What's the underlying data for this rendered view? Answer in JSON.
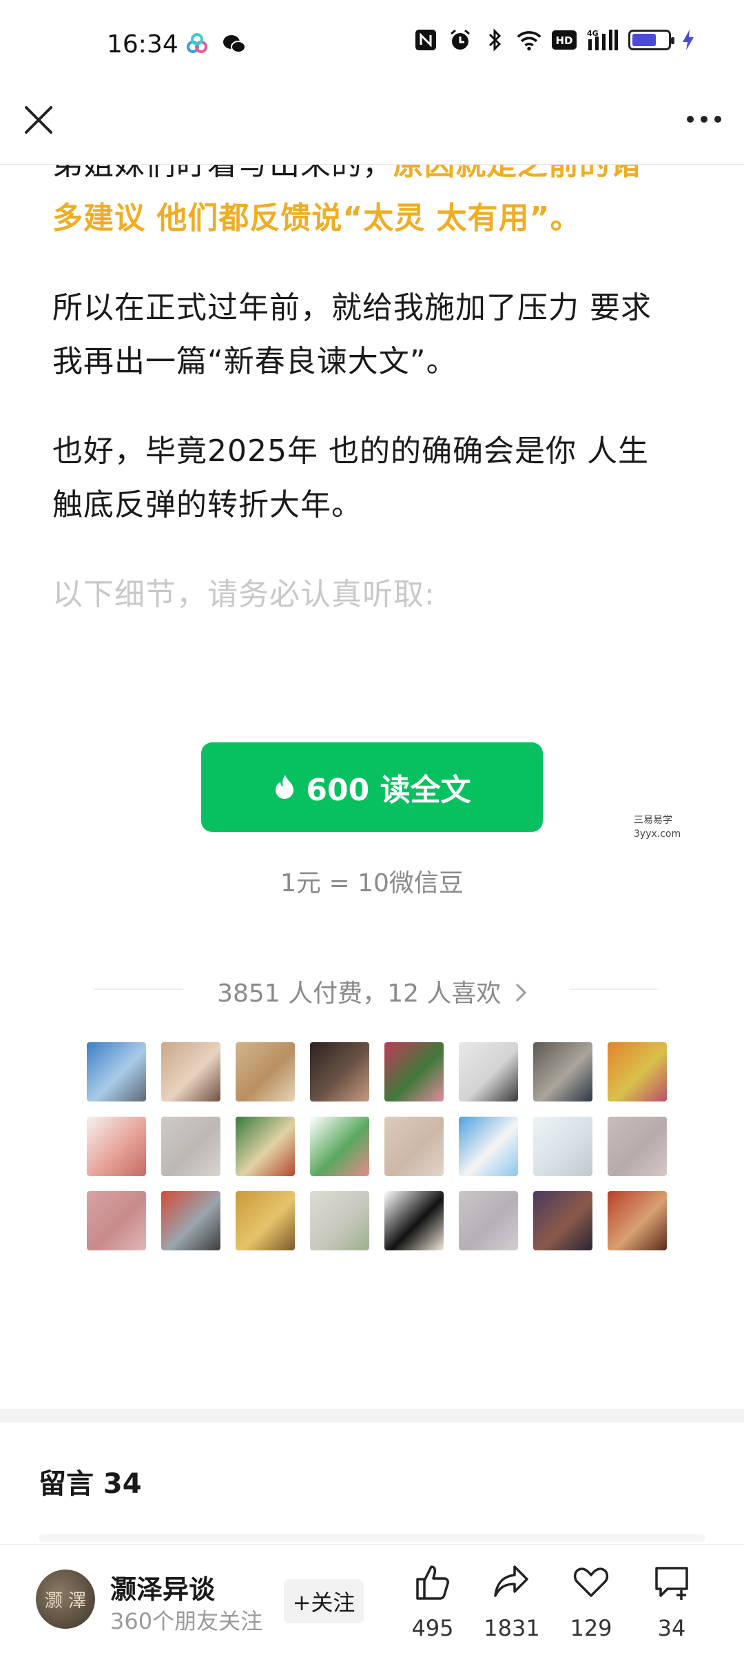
{
  "status_bar": {
    "time": "16:34",
    "network": "4G",
    "hd_label": "HD"
  },
  "nav": {
    "close_icon": "close-icon",
    "more_icon": "more-icon"
  },
  "article": {
    "p1_plain": "弟姐妹们盯着写出来的，",
    "p1_highlight_a": "原因就是之前的诸",
    "p1_highlight_b": "多建议 他们都反馈说“太灵 太有用”。",
    "p2_line1": "所以在正式过年前，就给我施加了压力 要求",
    "p2_line2": "我再出一篇“新春良谏大文”。",
    "p3_line1": "也好，毕竟2025年 也的的确确会是你 人生",
    "p3_line2": "触底反弹的转折大年。",
    "p4": "以下细节，请务必认真听取:"
  },
  "paywall": {
    "button_label": "600 读全文",
    "price_note": "1元 = 10微信豆",
    "watermark_line1": "三易易学",
    "watermark_line2": "3yyx.com",
    "accent_color": "#07c160"
  },
  "payers": {
    "summary": "3851 人付费，12 人喜欢",
    "avatars": [
      {
        "name": "avatar-1",
        "colors": [
          "#3f7fc4",
          "#a9cbe8",
          "#5b6a78"
        ]
      },
      {
        "name": "avatar-2",
        "colors": [
          "#c9a88a",
          "#e8d2bf",
          "#6d5140"
        ]
      },
      {
        "name": "avatar-3",
        "colors": [
          "#d1b58c",
          "#b98f62",
          "#e5d5b6"
        ]
      },
      {
        "name": "avatar-4",
        "colors": [
          "#2a2220",
          "#6b5446",
          "#c79a82"
        ]
      },
      {
        "name": "avatar-5",
        "colors": [
          "#c23a5c",
          "#3f7a3a",
          "#e58aa0"
        ]
      },
      {
        "name": "avatar-6",
        "colors": [
          "#e8e8e8",
          "#d3d3d3",
          "#3a3a3a"
        ]
      },
      {
        "name": "avatar-7",
        "colors": [
          "#5e5a54",
          "#a9a59b",
          "#2b3748"
        ]
      },
      {
        "name": "avatar-8",
        "colors": [
          "#e38230",
          "#d9c04a",
          "#b8506a"
        ]
      },
      {
        "name": "avatar-9",
        "colors": [
          "#f5f0ec",
          "#e7a39a",
          "#c46c62"
        ]
      },
      {
        "name": "avatar-10",
        "colors": [
          "#cfcac6",
          "#bdb8b3",
          "#d9d4cf"
        ]
      },
      {
        "name": "avatar-11",
        "colors": [
          "#3a7a3e",
          "#e0d3a6",
          "#b4482e"
        ]
      },
      {
        "name": "avatar-12",
        "colors": [
          "#ffffff",
          "#5aa85e",
          "#e88a8a"
        ]
      },
      {
        "name": "avatar-13",
        "colors": [
          "#dccabb",
          "#cdb8a8",
          "#e2d4c7"
        ]
      },
      {
        "name": "avatar-14",
        "colors": [
          "#4fa3e0",
          "#f4f4f4",
          "#8ec6ef"
        ]
      },
      {
        "name": "avatar-15",
        "colors": [
          "#eef3f5",
          "#d6e0e6",
          "#bfc9cf"
        ]
      },
      {
        "name": "avatar-16",
        "colors": [
          "#c9bcbc",
          "#b7aaaa",
          "#d5c8c8"
        ]
      },
      {
        "name": "avatar-17",
        "colors": [
          "#d6a3a3",
          "#c98b8b",
          "#e0b7b7"
        ]
      },
      {
        "name": "avatar-18",
        "colors": [
          "#d24a3a",
          "#9aa5ad",
          "#3d3d3d"
        ]
      },
      {
        "name": "avatar-19",
        "colors": [
          "#c99a3a",
          "#e6c36b",
          "#7a5a2a"
        ]
      },
      {
        "name": "avatar-20",
        "colors": [
          "#dcdcd4",
          "#c8c8be",
          "#9bb08a"
        ]
      },
      {
        "name": "avatar-21",
        "colors": [
          "#ffffff",
          "#111111",
          "#f0e6d8"
        ]
      },
      {
        "name": "avatar-22",
        "colors": [
          "#c8c4c8",
          "#b6b0b6",
          "#d2ced2"
        ]
      },
      {
        "name": "avatar-23",
        "colors": [
          "#4b3a5e",
          "#8a5a4a",
          "#2a2438"
        ]
      },
      {
        "name": "avatar-24",
        "colors": [
          "#b8402a",
          "#d8a070",
          "#5a2a1e"
        ]
      }
    ]
  },
  "comments": {
    "title": "留言 34"
  },
  "bottom_bar": {
    "author_name": "灏泽异谈",
    "followers": "360个朋友关注",
    "avatar_text": "灏 澤",
    "follow_label": "+关注",
    "like_count": "495",
    "share_count": "1831",
    "favorite_count": "129",
    "comment_count": "34"
  }
}
